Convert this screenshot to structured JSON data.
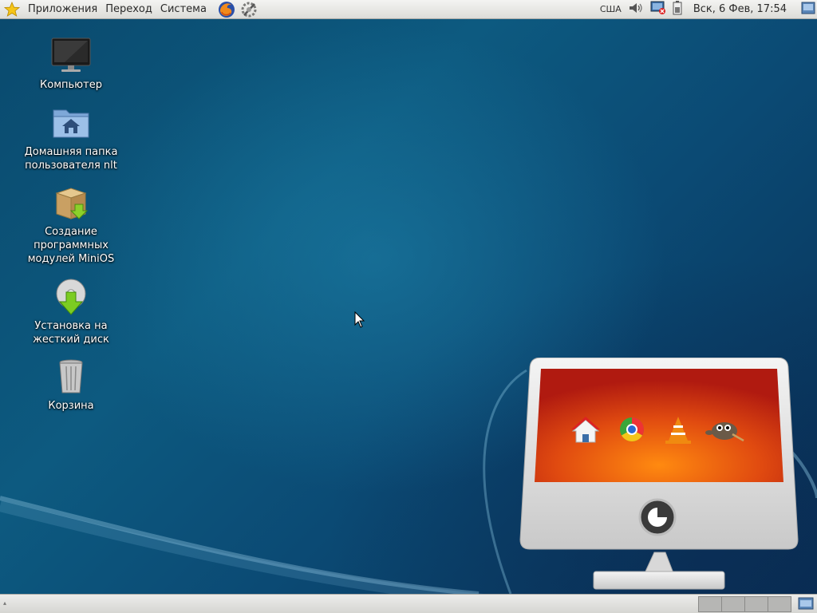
{
  "top_panel": {
    "menus": [
      "Приложения",
      "Переход",
      "Система"
    ],
    "keyboard_layout": "США",
    "clock": "Вск,  6 Фев, 17:54"
  },
  "desktop_icons": [
    {
      "label": "Компьютер",
      "icon": "computer-icon"
    },
    {
      "label": "Домашняя папка\nпользователя nlt",
      "icon": "home-folder-icon"
    },
    {
      "label": "Создание\nпрограммных\nмодулей MiniOS",
      "icon": "package-icon"
    },
    {
      "label": "Установка на\nжесткий диск",
      "icon": "install-disk-icon"
    },
    {
      "label": "Корзина",
      "icon": "trash-icon"
    }
  ],
  "wallpaper": {
    "monitor_apps": [
      "home-icon",
      "chrome-icon",
      "vlc-icon",
      "gimp-icon"
    ]
  },
  "bottom_panel": {
    "workspaces": 4
  },
  "colors": {
    "desktop": "#0b4a74",
    "panel": "#e4e4e0",
    "monitor_screen": "#e04a10"
  }
}
